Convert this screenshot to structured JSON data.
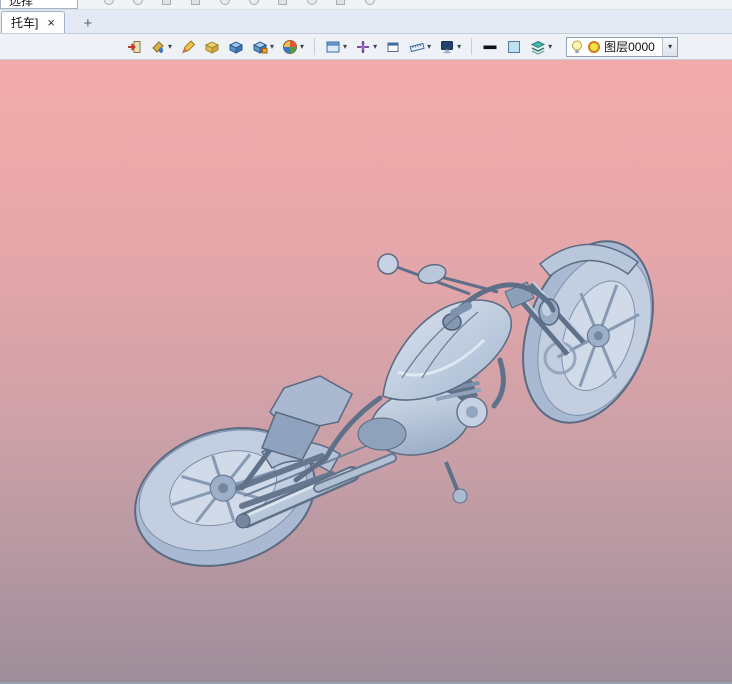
{
  "ui": {
    "chevron": "▾"
  },
  "top_strip": {
    "selection_label": "选择"
  },
  "tab_bar": {
    "active_tab_label": "托车]",
    "close_label": "×",
    "new_tab_label": "+"
  },
  "toolbar": {
    "icons": [
      "exit-icon",
      "material-paint-icon",
      "pencil-icon",
      "open-box-icon",
      "cube-icon",
      "cube-options-icon",
      "color-wheel-icon",
      "viewport-window-icon",
      "move-origin-icon",
      "small-window-icon",
      "ruler-icon",
      "display-icon",
      "line-width-icon",
      "color-swatch-icon",
      "material-layers-icon"
    ],
    "layer_combo": {
      "value": "图层0000"
    }
  },
  "viewport": {
    "model": "motorcycle",
    "bg_top": "#f2abab",
    "bg_bottom": "#9e8e9a",
    "model_color": "#b9c7db"
  }
}
